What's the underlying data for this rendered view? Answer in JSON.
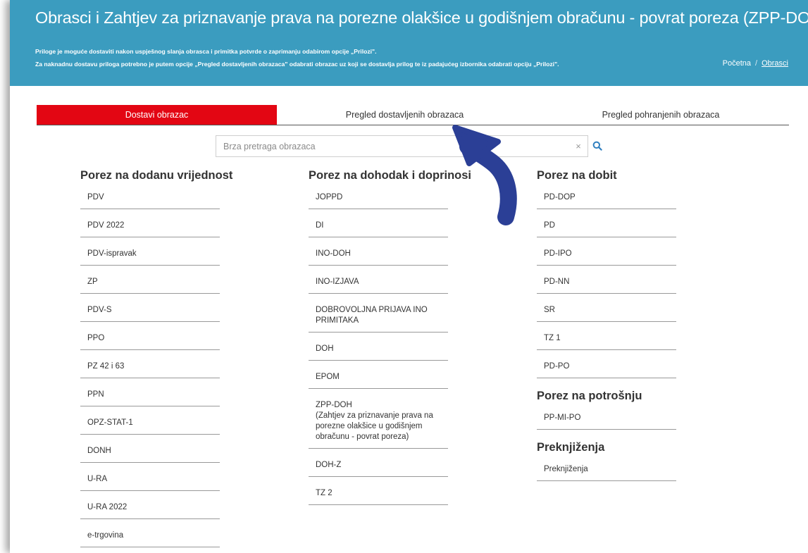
{
  "header": {
    "title": "Obrasci i Zahtjev za priznavanje prava na porezne olakšice u godišnjem obračunu - povrat poreza (ZPP-DOH)",
    "note1": "Priloge je moguće dostaviti nakon uspješnog slanja obrasca i primitka potvrde o zaprimanju odabirom opcije „Prilozi\".",
    "note2": "Za naknadnu dostavu priloga potrebno je putem opcije „Pregled dostavljenih obrazaca\" odabrati obrazac uz koji se dostavlja prilog te iz padajućeg izbornika odabrati opciju „Prilozi\".",
    "breadcrumb": {
      "home": "Početna",
      "separator": "/",
      "current": "Obrasci"
    },
    "background_color": "#3b9cbf"
  },
  "tabs": [
    {
      "label": "Dostavi obrazac",
      "active": true
    },
    {
      "label": "Pregled dostavljenih obrazaca",
      "active": false
    },
    {
      "label": "Pregled pohranjenih obrazaca",
      "active": false
    }
  ],
  "accent_color": "#e30613",
  "search": {
    "placeholder": "Brza pretraga obrazaca",
    "clear_icon": "×",
    "search_icon": "search-icon"
  },
  "columns": [
    {
      "groups": [
        {
          "title": "Porez na dodanu vrijednost",
          "items": [
            "PDV",
            "PDV 2022",
            "PDV-ispravak",
            "ZP",
            "PDV-S",
            "PPO",
            "PZ 42 i 63",
            "PPN",
            "OPZ-STAT-1",
            "DONH",
            "U-RA",
            "U-RA 2022",
            "e-trgovina"
          ]
        }
      ]
    },
    {
      "groups": [
        {
          "title": "Porez na dohodak i doprinosi",
          "items": [
            "JOPPD",
            "DI",
            "INO-DOH",
            "INO-IZJAVA",
            "DOBROVOLJNA PRIJAVA INO PRIMITAKA",
            "DOH",
            "EPOM",
            "ZPP-DOH\n(Zahtjev za priznavanje prava na porezne olakšice u godišnjem obračunu - povrat poreza)",
            "DOH-Z",
            "TZ 2"
          ]
        }
      ]
    },
    {
      "groups": [
        {
          "title": "Porez na dobit",
          "items": [
            "PD-DOP",
            "PD",
            "PD-IPO",
            "PD-NN",
            "SR",
            "TZ 1",
            "PD-PO"
          ]
        },
        {
          "title": "Porez na potrošnju",
          "items": [
            "PP-MI-PO"
          ]
        },
        {
          "title": "Preknjiženja",
          "items": [
            "Preknjiženja"
          ]
        }
      ]
    }
  ],
  "annotation": {
    "icon": "curved-arrow-icon",
    "color": "#2b3f96"
  }
}
